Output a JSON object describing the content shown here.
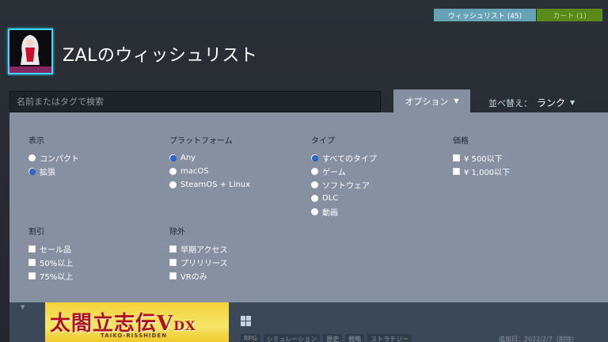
{
  "header": {
    "wishlist_label": "ウィッシュリスト (45)",
    "cart_label": "カート (1)",
    "title": "ZALのウィッシュリスト"
  },
  "toolbar": {
    "search_placeholder": "名前またはタグで検索",
    "options_label": "オプション",
    "sort_label": "並べ替え：",
    "sort_value": "ランク"
  },
  "options": {
    "display": {
      "title": "表示",
      "items": [
        {
          "label": "コンパクト",
          "selected": false
        },
        {
          "label": "拡張",
          "selected": true
        }
      ]
    },
    "platform": {
      "title": "プラットフォーム",
      "items": [
        {
          "label": "Any",
          "selected": true
        },
        {
          "label": "macOS",
          "selected": false
        },
        {
          "label": "SteamOS + Linux",
          "selected": false
        }
      ]
    },
    "type": {
      "title": "タイプ",
      "items": [
        {
          "label": "すべてのタイプ",
          "selected": true
        },
        {
          "label": "ゲーム",
          "selected": false
        },
        {
          "label": "ソフトウェア",
          "selected": false
        },
        {
          "label": "DLC",
          "selected": false
        },
        {
          "label": "動画",
          "selected": false
        }
      ]
    },
    "price": {
      "title": "価格",
      "items": [
        {
          "label": "¥ 500以下",
          "checked": false
        },
        {
          "label": "¥ 1,000以下",
          "checked": false
        }
      ]
    },
    "discount": {
      "title": "割引",
      "items": [
        {
          "label": "セール品",
          "checked": false
        },
        {
          "label": "50%以上",
          "checked": false
        },
        {
          "label": "75%以上",
          "checked": false
        }
      ]
    },
    "exclude": {
      "title": "除外",
      "items": [
        {
          "label": "早期アクセス",
          "checked": false
        },
        {
          "label": "プリリリース",
          "checked": false
        },
        {
          "label": "VRのみ",
          "checked": false
        }
      ]
    }
  },
  "game": {
    "capsule_title": "太閤立志伝V",
    "capsule_dx": "DX",
    "capsule_subtitle": "TAIKO-RISSHIDEN",
    "platform_icon": "windows-icon",
    "tags": [
      "RPG",
      "シミュレーション",
      "歴史",
      "戦略",
      "ストラテジー"
    ],
    "added_text": "追加日：2022/2/7（削除）"
  },
  "colors": {
    "accent_blue": "#67a3b7",
    "cart_green": "#5c8a1a",
    "panel": "#8690a1",
    "radio_selected": "#2d6bd8"
  }
}
